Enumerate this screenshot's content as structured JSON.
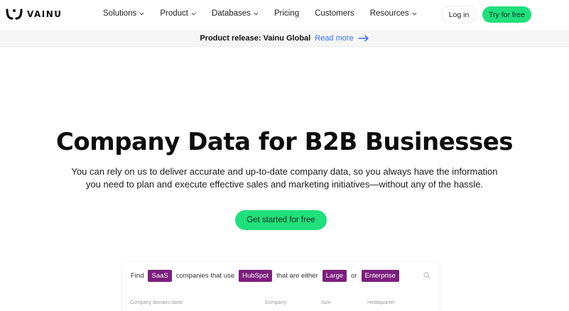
{
  "brand": {
    "name": "VAINU",
    "accent": "#20e07c",
    "chip_color": "#7b1f7d",
    "link_color": "#3b6ef5"
  },
  "nav": {
    "items": [
      {
        "label": "Solutions",
        "has_dropdown": true
      },
      {
        "label": "Product",
        "has_dropdown": true
      },
      {
        "label": "Databases",
        "has_dropdown": true
      },
      {
        "label": "Pricing",
        "has_dropdown": false
      },
      {
        "label": "Customers",
        "has_dropdown": false
      },
      {
        "label": "Resources",
        "has_dropdown": true
      }
    ],
    "login_label": "Log in",
    "try_label": "Try for free"
  },
  "announcement": {
    "text": "Product release: Vainu Global",
    "link_label": "Read more"
  },
  "hero": {
    "title": "Company Data for B2B Businesses",
    "subtitle_line1": "You can rely on us to deliver accurate and up-to-date company data, so you always have the information",
    "subtitle_line2": "you need to plan and execute effective sales and marketing initiatives—without any of the hassle.",
    "cta_label": "Get started for free"
  },
  "search_demo": {
    "find": "Find",
    "chip1": "SaaS",
    "text1": "companies that use",
    "chip2": "HubSpot",
    "text2": "that are either",
    "chip3": "Large",
    "text3": "or",
    "chip4": "Enterprise",
    "columns": [
      "Company domain name",
      "Company",
      "Size",
      "Headquarter"
    ]
  }
}
